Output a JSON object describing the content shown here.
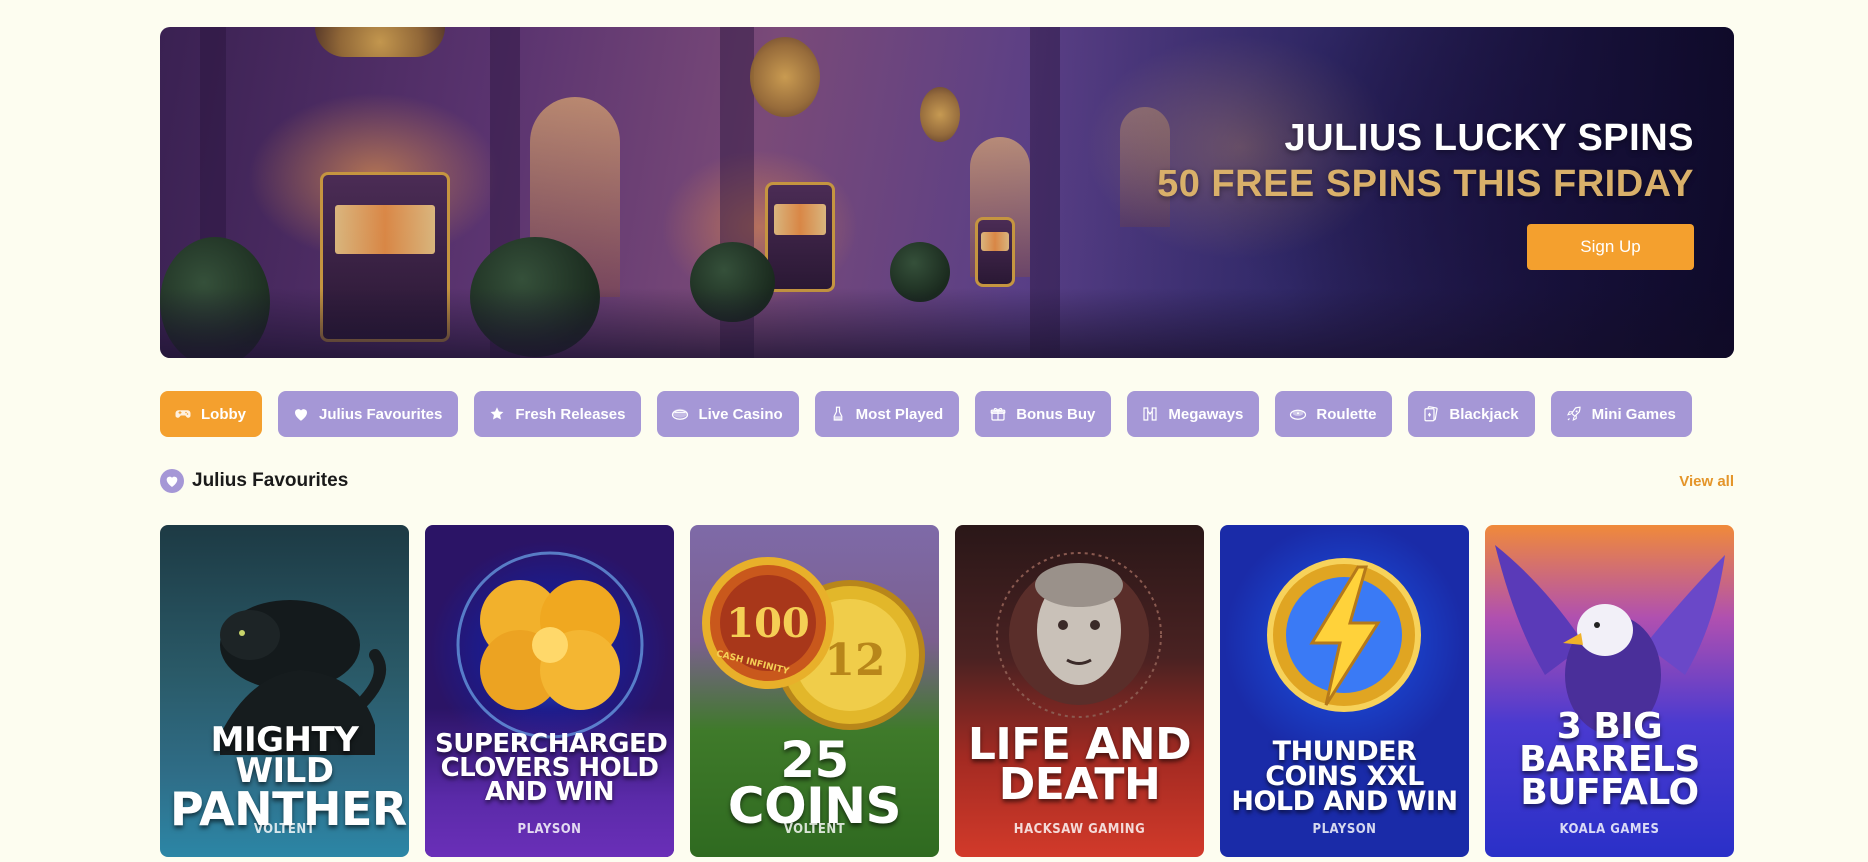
{
  "hero": {
    "title": "JULIUS LUCKY SPINS",
    "subtitle": "50 FREE SPINS THIS FRIDAY",
    "signup_label": "Sign Up"
  },
  "categories": [
    {
      "label": "Lobby",
      "icon": "gamepad-icon",
      "active": true
    },
    {
      "label": "Julius Favourites",
      "icon": "heart-icon",
      "active": false
    },
    {
      "label": "Fresh Releases",
      "icon": "star-icon",
      "active": false
    },
    {
      "label": "Live Casino",
      "icon": "live-casino-icon",
      "active": false
    },
    {
      "label": "Most Played",
      "icon": "trophy-icon",
      "active": false
    },
    {
      "label": "Bonus Buy",
      "icon": "gift-icon",
      "active": false
    },
    {
      "label": "Megaways",
      "icon": "megaways-icon",
      "active": false
    },
    {
      "label": "Roulette",
      "icon": "roulette-icon",
      "active": false
    },
    {
      "label": "Blackjack",
      "icon": "cards-icon",
      "active": false
    },
    {
      "label": "Mini Games",
      "icon": "rocket-icon",
      "active": false
    }
  ],
  "section": {
    "title": "Julius Favourites",
    "icon": "heart-icon",
    "view_all_label": "View all"
  },
  "games": [
    {
      "title_line1": "Mighty Wild",
      "title_line2": "Panther",
      "provider": "Voltent"
    },
    {
      "title_line1": "Supercharged",
      "title_line2": "Clovers Hold and Win",
      "provider": "Playson"
    },
    {
      "title_line1": "25 Coins",
      "title_line2": "",
      "provider": "Voltent",
      "coin_badge": "100",
      "coin_badge_2": "12",
      "coin_badge_caption": "CASH INFINITY"
    },
    {
      "title_line1": "Life and",
      "title_line2": "Death",
      "provider": "Hacksaw Gaming"
    },
    {
      "title_line1": "Thunder Coins XXL",
      "title_line2": "Hold and Win",
      "provider": "Playson"
    },
    {
      "title_line1": "3 Big Barrels",
      "title_line2": "Buffalo",
      "provider": "Koala Games"
    }
  ],
  "colors": {
    "accent": "#f4a02e",
    "category": "#a597d6",
    "background": "#fdfdf0",
    "hero_subtitle": "#d9b06a"
  }
}
